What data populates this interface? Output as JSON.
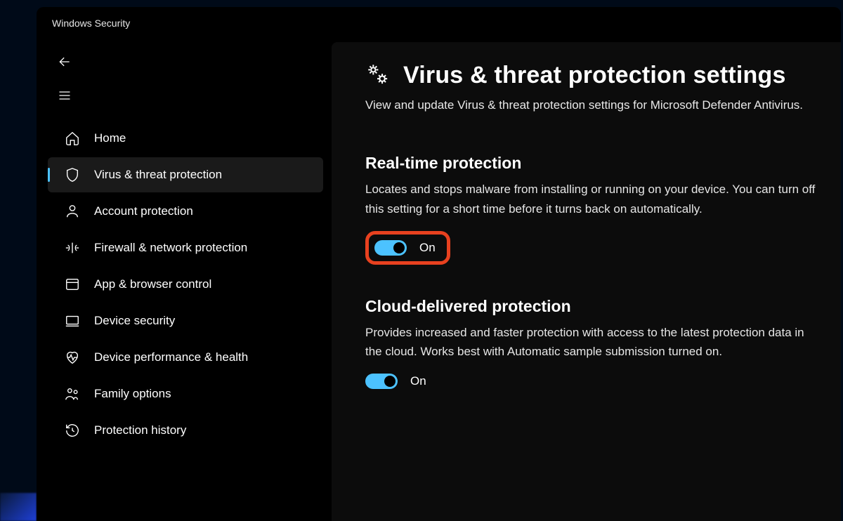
{
  "window": {
    "title": "Windows Security"
  },
  "sidebar": {
    "items": [
      {
        "id": "home",
        "label": "Home",
        "active": false
      },
      {
        "id": "virus",
        "label": "Virus & threat protection",
        "active": true
      },
      {
        "id": "account",
        "label": "Account protection",
        "active": false
      },
      {
        "id": "firewall",
        "label": "Firewall & network protection",
        "active": false
      },
      {
        "id": "app",
        "label": "App & browser control",
        "active": false
      },
      {
        "id": "device",
        "label": "Device security",
        "active": false
      },
      {
        "id": "perf",
        "label": "Device performance & health",
        "active": false
      },
      {
        "id": "family",
        "label": "Family options",
        "active": false
      },
      {
        "id": "history",
        "label": "Protection history",
        "active": false
      }
    ]
  },
  "page": {
    "title": "Virus & threat protection settings",
    "description": "View and update Virus & threat protection settings for Microsoft Defender Antivirus."
  },
  "sections": {
    "realtime": {
      "title": "Real-time protection",
      "description": "Locates and stops malware from installing or running on your device. You can turn off this setting for a short time before it turns back on automatically.",
      "toggle_on": true,
      "toggle_label": "On",
      "highlighted": true
    },
    "cloud": {
      "title": "Cloud-delivered protection",
      "description": "Provides increased and faster protection with access to the latest protection data in the cloud. Works best with Automatic sample submission turned on.",
      "toggle_on": true,
      "toggle_label": "On",
      "highlighted": false
    }
  },
  "colors": {
    "accent": "#4cc2ff",
    "highlight": "#e8411f"
  }
}
